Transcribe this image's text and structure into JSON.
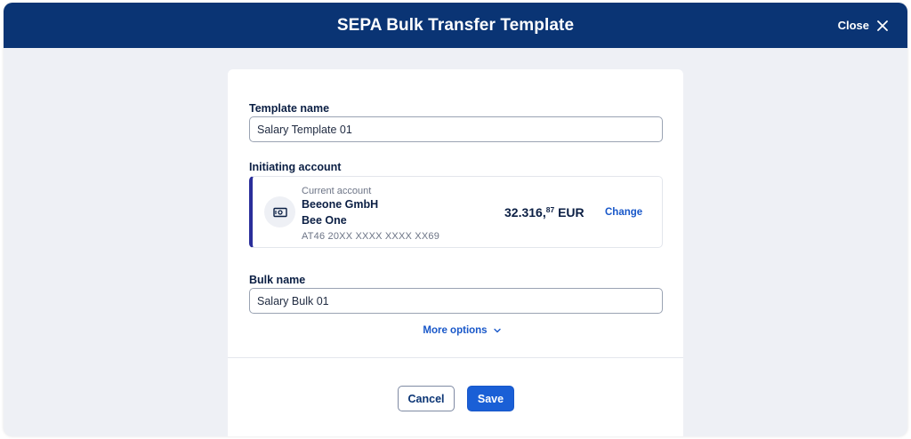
{
  "header": {
    "title": "SEPA Bulk Transfer Template",
    "close_label": "Close"
  },
  "form": {
    "template_name": {
      "label": "Template name",
      "value": "Salary Template 01"
    },
    "initiating_account": {
      "label": "Initiating account",
      "account_type": "Current account",
      "company": "Beeone GmbH",
      "name": "Bee One",
      "iban": "AT46 20XX XXXX XXXX XX69",
      "balance_main": "32.316,",
      "balance_decimals": "87",
      "currency": " EUR",
      "change_label": "Change",
      "icon": "banknote-icon",
      "accent_color": "#2a2e9a"
    },
    "bulk_name": {
      "label": "Bulk name",
      "value": "Salary Bulk 01"
    },
    "more_options_label": "More options"
  },
  "actions": {
    "cancel_label": "Cancel",
    "save_label": "Save"
  },
  "colors": {
    "header_bg": "#0a3474",
    "primary": "#1a5fd6",
    "link": "#1857c9",
    "page_bg": "#eef0f5"
  }
}
